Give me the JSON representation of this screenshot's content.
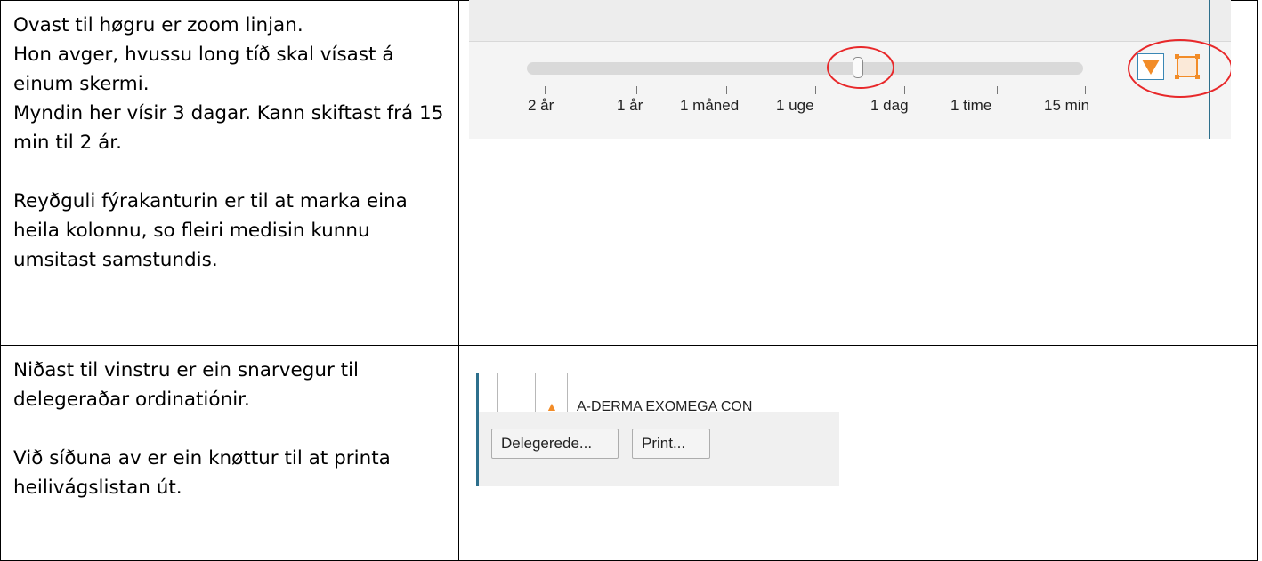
{
  "row1": {
    "lines": [
      "Ovast til høgru er zoom linjan.",
      "Hon avger, hvussu long tíð skal vísast á einum skermi.",
      "Myndin her vísir 3 dagar. Kann skiftast frá 15 min til 2 ár."
    ],
    "paragraph2": "Reyðguli fýrakanturin er til at marka eina heila kolonnu, so fleiri medisin kunnu umsitast samstundis."
  },
  "zoom": {
    "tick_labels": [
      "2 år",
      "1 år",
      "1 måned",
      "1 uge",
      "1 dag",
      "1 time",
      "15 min"
    ],
    "slider_value_label": "3 dagar",
    "accent_color": "#f28c28",
    "highlight_color": "#e8282a",
    "icons": [
      "dropdown-triangle-icon",
      "select-column-square-icon"
    ]
  },
  "row2": {
    "paragraph1": "Niðast til vinstru er ein snarvegur til delegeraðar ordinatiónir.",
    "paragraph2": "Við síðuna av er ein knøttur til at printa heilivágslistan út."
  },
  "deleg": {
    "drug_name": "A-DERMA EXOMEGA CON",
    "delegerede_label": "Delegerede...",
    "print_label": "Print...",
    "warning_icon": "warning-triangle-icon"
  }
}
